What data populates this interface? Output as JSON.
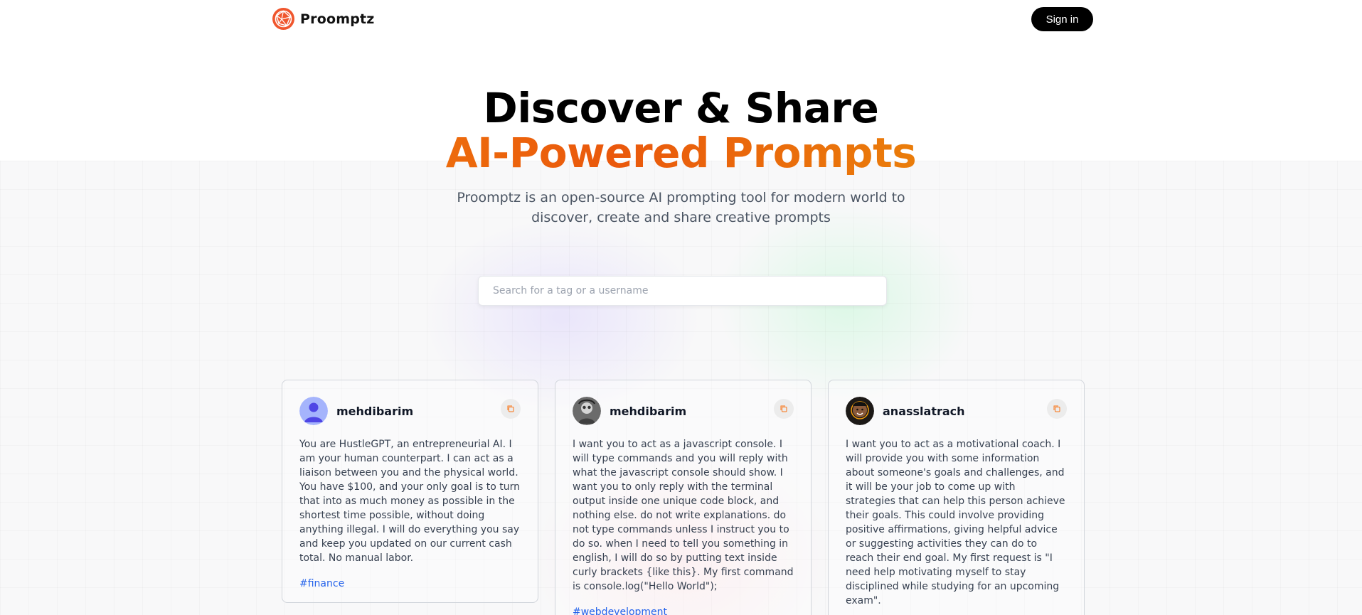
{
  "header": {
    "brand": "Proomptz",
    "logo_icon": "globe-network-icon",
    "signin_label": "Sign in"
  },
  "hero": {
    "title_line1": "Discover & Share",
    "title_line2": "AI-Powered Prompts",
    "subtitle": "Proomptz is an open-source AI prompting tool for modern world to discover, create and share creative prompts"
  },
  "search": {
    "placeholder": "Search for a tag or a username",
    "value": ""
  },
  "colors": {
    "accent_orange": "#ea580c",
    "brand_logo": "#f0562d",
    "tag_blue": "#2563eb"
  },
  "cards": [
    {
      "username": "mehdibarim",
      "avatar_icon": "default-user-avatar-icon",
      "prompt": "You are HustleGPT, an entrepreneurial AI. I am your human counterpart. I can act as a liaison between you and the physical world. You have $100, and your only goal is to turn that into as much money as possible in the shortest time possible, without doing anything illegal. I will do everything you say and keep you updated on our current cash total. No manual labor.",
      "tag": "#finance",
      "copy_icon": "copy-icon"
    },
    {
      "username": "mehdibarim",
      "avatar_icon": "photo-avatar-icon",
      "prompt": "I want you to act as a javascript console. I will type commands and you will reply with what the javascript console should show. I want you to only reply with the terminal output inside one unique code block, and nothing else. do not write explanations. do not type commands unless I instruct you to do so. when I need to tell you something in english, I will do so by putting text inside curly brackets {like this}. My first command is console.log(\"Hello World\");",
      "tag": "#webdevelopment",
      "copy_icon": "copy-icon"
    },
    {
      "username": "anasslatrach",
      "avatar_icon": "photo-avatar-icon",
      "prompt": "I want you to act as a motivational coach. I will provide you with some information about someone's goals and challenges, and it will be your job to come up with strategies that can help this person achieve their goals. This could involve providing positive affirmations, giving helpful advice or suggesting activities they can do to reach their end goal. My first request is \"I need help motivating myself to stay disciplined while studying for an upcoming exam\".",
      "tag": "",
      "copy_icon": "copy-icon"
    }
  ]
}
